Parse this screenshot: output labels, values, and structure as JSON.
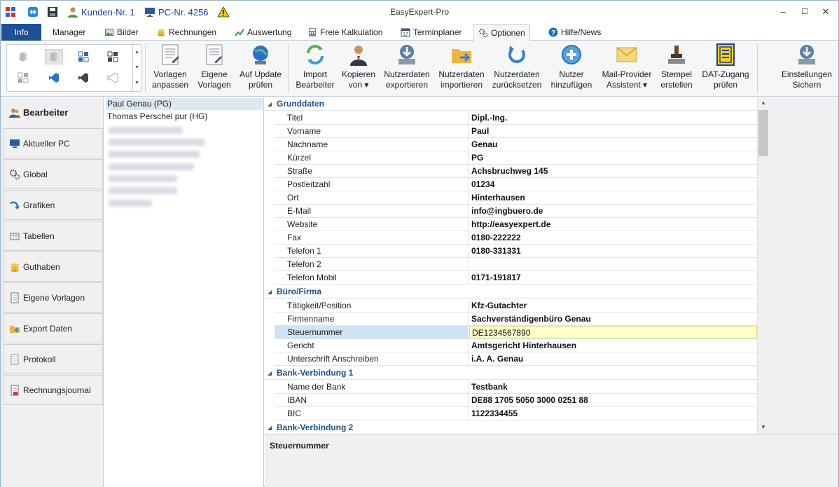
{
  "titlebar": {
    "app_title": "EasyExpert-Pro",
    "kunden": "Kunden-Nr. 1",
    "pc": "PC-Nr. 4256"
  },
  "tabs": [
    {
      "label": "Info"
    },
    {
      "label": "Manager"
    },
    {
      "label": "Bilder"
    },
    {
      "label": "Rechnungen"
    },
    {
      "label": "Auswertung"
    },
    {
      "label": "Freie Kalkulation"
    },
    {
      "label": "Terminplaner"
    },
    {
      "label": "Optionen"
    },
    {
      "label": "Hilfe/News"
    }
  ],
  "ribbon": {
    "vorlagen_anpassen": [
      "Vorlagen",
      "anpassen"
    ],
    "eigene_vorlagen": [
      "Eigene",
      "Vorlagen"
    ],
    "auf_update": [
      "Auf Update",
      "prüfen"
    ],
    "import_bearbeiter": [
      "Import",
      "Bearbeiter"
    ],
    "kopieren_von": [
      "Kopieren",
      "von ▾"
    ],
    "nutzerdaten_exportieren": [
      "Nutzerdaten",
      "exportieren"
    ],
    "nutzerdaten_importieren": [
      "Nutzerdaten",
      "importieren"
    ],
    "nutzerdaten_zuruecksetzen": [
      "Nutzerdaten",
      "zurücksetzen"
    ],
    "nutzer_hinzufuegen": [
      "Nutzer",
      "hinzufügen"
    ],
    "mail_provider": [
      "Mail-Provider",
      "Assistent ▾"
    ],
    "stempel": [
      "Stempel",
      "erstellen"
    ],
    "dat_zugang": [
      "DAT-Zugang",
      "prüfen"
    ],
    "einstellungen": [
      "Einstellungen",
      "Sichern"
    ]
  },
  "nav": [
    {
      "label": "Bearbeiter"
    },
    {
      "label": "Aktueller PC"
    },
    {
      "label": "Global"
    },
    {
      "label": "Grafiken"
    },
    {
      "label": "Tabellen"
    },
    {
      "label": "Guthaben"
    },
    {
      "label": "Eigene Vorlagen"
    },
    {
      "label": "Export Daten"
    },
    {
      "label": "Protokoll"
    },
    {
      "label": "Rechnungsjournal"
    }
  ],
  "users": [
    {
      "label": "Paul Genau (PG)"
    },
    {
      "label": "Thomas Perschel pur (HG)"
    }
  ],
  "grid": {
    "grunddaten": {
      "title": "Grunddaten",
      "rows": [
        {
          "k": "Titel",
          "v": "Dipl.-Ing."
        },
        {
          "k": "Vorname",
          "v": "Paul"
        },
        {
          "k": "Nachname",
          "v": "Genau"
        },
        {
          "k": "Kürzel",
          "v": "PG"
        },
        {
          "k": "Straße",
          "v": "Achsbruchweg 145"
        },
        {
          "k": "Postleitzahl",
          "v": "01234"
        },
        {
          "k": "Ort",
          "v": "Hinterhausen"
        },
        {
          "k": "E-Mail",
          "v": "info@ingbuero.de"
        },
        {
          "k": "Website",
          "v": "http://easyexpert.de"
        },
        {
          "k": "Fax",
          "v": "0180-222222"
        },
        {
          "k": "Telefon 1",
          "v": "0180-331331"
        },
        {
          "k": "Telefon 2",
          "v": ""
        },
        {
          "k": "Telefon Mobil",
          "v": "0171-191817"
        }
      ]
    },
    "buero": {
      "title": "Büro/Firma",
      "rows": [
        {
          "k": "Tätigkeit/Position",
          "v": "Kfz-Gutachter"
        },
        {
          "k": "Firmenname",
          "v": "Sachverständigenbüro Genau"
        },
        {
          "k": "Steuernummer",
          "v": "DE1234567890"
        },
        {
          "k": "Gericht",
          "v": "Amtsgericht Hinterhausen"
        },
        {
          "k": "Unterschrift Anschreiben",
          "v": "i.A. A. Genau"
        }
      ]
    },
    "bank1": {
      "title": "Bank-Verbindung 1",
      "rows": [
        {
          "k": "Name der Bank",
          "v": "Testbank"
        },
        {
          "k": "IBAN",
          "v": "DE88 1705 5050 3000 0251 88"
        },
        {
          "k": "BIC",
          "v": "1122334455"
        }
      ]
    },
    "bank2": {
      "title": "Bank-Verbindung 2"
    }
  },
  "description": {
    "title": "Steuernummer"
  },
  "colors": {
    "accent": "#1f4f96",
    "category": "#1e4f8a",
    "selected_value_bg": "#ffffcc"
  }
}
